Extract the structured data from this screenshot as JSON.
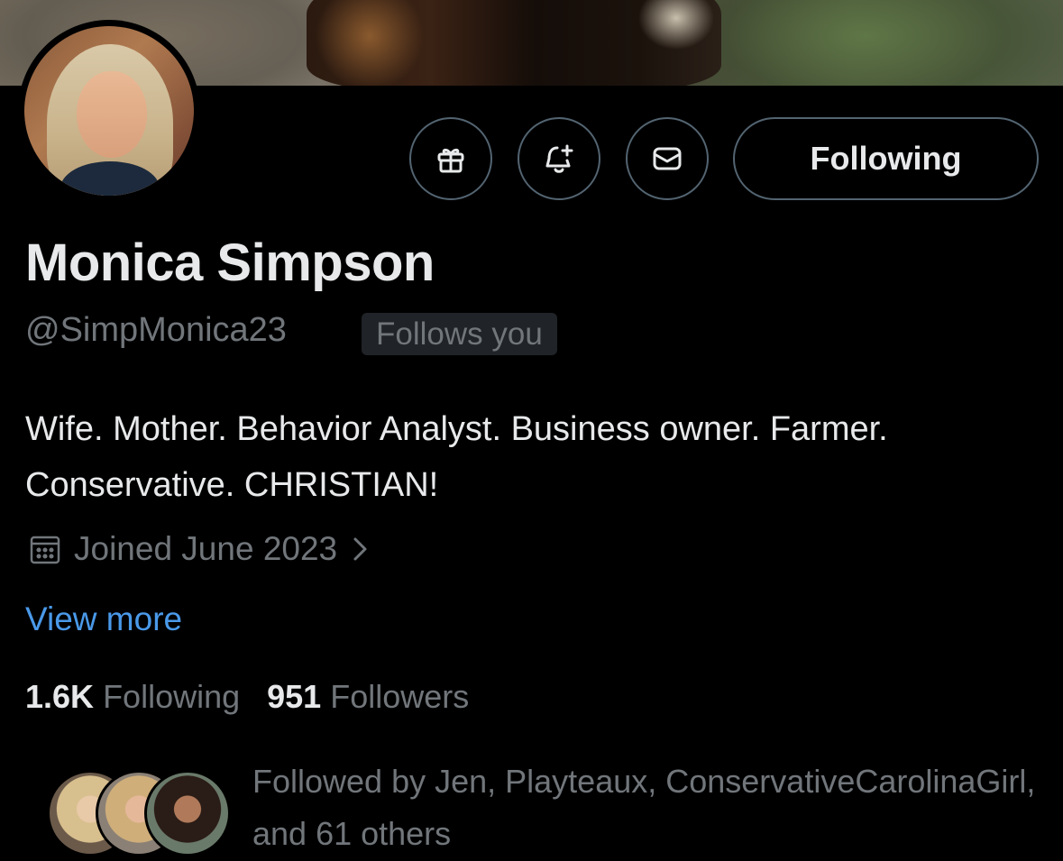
{
  "profile": {
    "display_name": "Monica Simpson",
    "handle": "@SimpMonica23",
    "follows_you_badge": "Follows you",
    "bio": "Wife. Mother. Behavior Analyst. Business owner. Farmer. Conservative. CHRISTIAN!",
    "joined": "Joined June 2023",
    "view_more": "View more"
  },
  "actions": {
    "gift_icon": "gift-icon",
    "notify_icon": "bell-plus-icon",
    "message_icon": "envelope-icon",
    "follow_state_label": "Following"
  },
  "stats": {
    "following_count": "1.6K",
    "following_label": "Following",
    "followers_count": "951",
    "followers_label": "Followers"
  },
  "followed_by": {
    "text": "Followed by Jen, Playteaux, ConservativeCarolinaGirl, and 61 others"
  },
  "colors": {
    "background": "#000000",
    "primary_text": "#e7e9ea",
    "secondary_text": "#71767b",
    "link": "#4a99e9",
    "border": "#536471"
  }
}
